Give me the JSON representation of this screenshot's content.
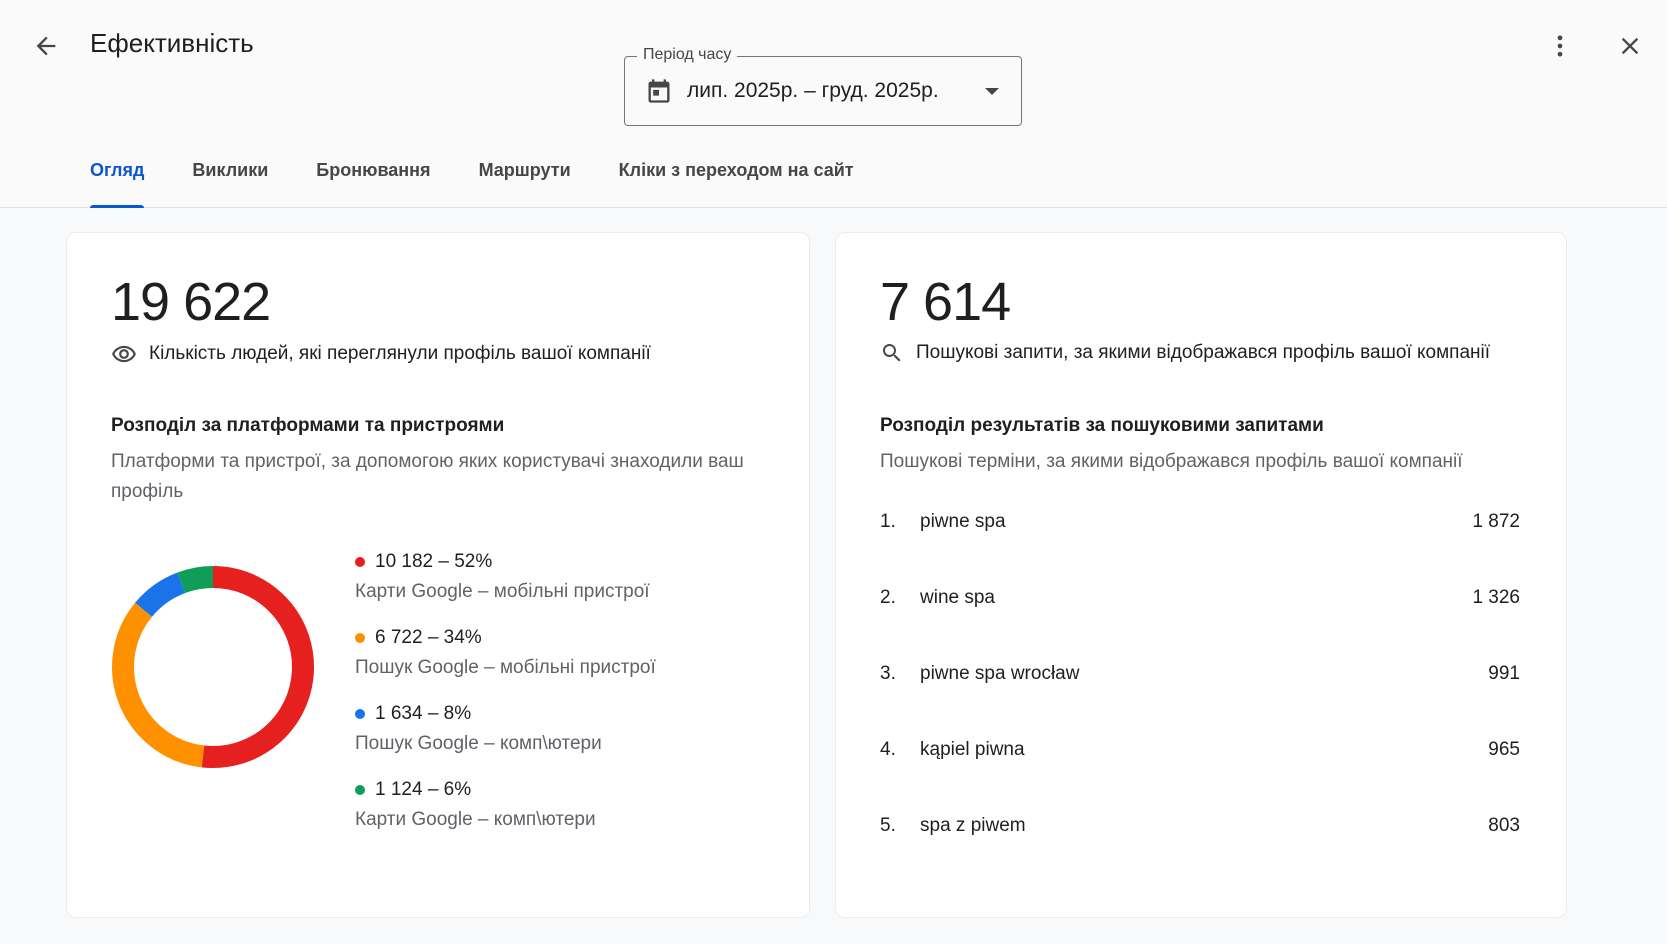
{
  "header": {
    "title": "Ефективність",
    "period_label": "Період часу",
    "period_value": "лип. 2025р. – груд. 2025р."
  },
  "tabs": [
    {
      "label": "Огляд",
      "active": true
    },
    {
      "label": "Виклики",
      "active": false
    },
    {
      "label": "Бронювання",
      "active": false
    },
    {
      "label": "Маршрути",
      "active": false
    },
    {
      "label": "Кліки з переходом на сайт",
      "active": false
    }
  ],
  "profile_views": {
    "value": "19 622",
    "label": "Кількість людей, які переглянули профіль вашої компанії",
    "breakdown_title": "Розподіл за платформами та пристроями",
    "breakdown_subtitle": "Платформи та пристрої, за допомогою яких користувачі знаходили ваш профіль",
    "segments": [
      {
        "value_text": "10 182 – 52%",
        "value": 10182,
        "percent": 52,
        "desc": "Карти Google – мобільні пристрої",
        "color": "#e5201f"
      },
      {
        "value_text": "6 722 – 34%",
        "value": 6722,
        "percent": 34,
        "desc": "Пошук Google – мобільні пристрої",
        "color": "#ff9100"
      },
      {
        "value_text": "1 634 – 8%",
        "value": 1634,
        "percent": 8,
        "desc": "Пошук Google – комп\\ютери",
        "color": "#1a73e8"
      },
      {
        "value_text": "1 124 – 6%",
        "value": 1124,
        "percent": 6,
        "desc": "Карти Google – комп\\ютери",
        "color": "#0f9d58"
      }
    ]
  },
  "search_queries": {
    "value": "7 614",
    "label": "Пошукові запити, за якими відображався профіль вашої компанії",
    "breakdown_title": "Розподіл результатів за пошуковими запитами",
    "breakdown_subtitle": "Пошукові терміни, за якими відображався профіль вашої компанії",
    "items": [
      {
        "rank": "1.",
        "term": "piwne spa",
        "count": "1 872"
      },
      {
        "rank": "2.",
        "term": "wine spa",
        "count": "1 326"
      },
      {
        "rank": "3.",
        "term": "piwne spa wrocław",
        "count": "991"
      },
      {
        "rank": "4.",
        "term": "kąpiel piwna",
        "count": "965"
      },
      {
        "rank": "5.",
        "term": "spa z piwem",
        "count": "803"
      }
    ]
  },
  "icons": {
    "back": "arrow-back-icon",
    "more": "more-vert-icon",
    "close": "close-icon",
    "calendar": "calendar-icon",
    "views": "eye-icon",
    "search": "search-icon"
  }
}
